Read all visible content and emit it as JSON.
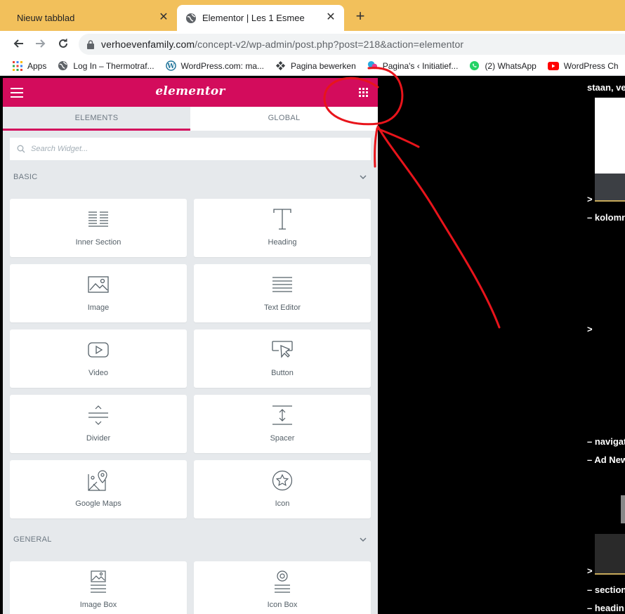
{
  "browser": {
    "tabs": [
      {
        "title": "Nieuw tabblad",
        "active": false
      },
      {
        "title": "Elementor | Les 1 Esmee",
        "active": true
      }
    ],
    "close_glyph": "✕",
    "new_tab_glyph": "+",
    "url_main": "verhoevenfamily.com",
    "url_path": "/concept-v2/wp-admin/post.php?post=218&action=elementor",
    "bookmarks": [
      {
        "label": "Apps",
        "icon": "apps-grid-icon"
      },
      {
        "label": "Log In – Thermotraf...",
        "icon": "globe-icon"
      },
      {
        "label": "WordPress.com: ma...",
        "icon": "wordpress-icon"
      },
      {
        "label": "Pagina bewerken",
        "icon": "puzzle-icon"
      },
      {
        "label": "Pagina's ‹ Initiatief...",
        "icon": "bookmark-icon"
      },
      {
        "label": "(2) WhatsApp",
        "icon": "whatsapp-icon"
      },
      {
        "label": "WordPress Ch",
        "icon": "youtube-icon"
      }
    ]
  },
  "elementor": {
    "logo": "elementor",
    "tabs": [
      "ELEMENTS",
      "GLOBAL"
    ],
    "search_placeholder": "Search Widget...",
    "categories": {
      "basic": "BASIC",
      "general": "GENERAL"
    },
    "basic_widgets": [
      {
        "label": "Inner Section",
        "icon": "inner-section-icon"
      },
      {
        "label": "Heading",
        "icon": "heading-icon"
      },
      {
        "label": "Image",
        "icon": "image-icon"
      },
      {
        "label": "Text Editor",
        "icon": "text-editor-icon"
      },
      {
        "label": "Video",
        "icon": "video-icon"
      },
      {
        "label": "Button",
        "icon": "button-icon"
      },
      {
        "label": "Divider",
        "icon": "divider-icon"
      },
      {
        "label": "Spacer",
        "icon": "spacer-icon"
      },
      {
        "label": "Google Maps",
        "icon": "google-maps-icon"
      },
      {
        "label": "Icon",
        "icon": "star-icon"
      }
    ],
    "general_widgets": [
      {
        "label": "Image Box",
        "icon": "image-box-icon"
      },
      {
        "label": "Icon Box",
        "icon": "icon-box-icon"
      }
    ]
  },
  "preview": {
    "lines": [
      "staan, ve",
      ">",
      "– kolomn",
      ">",
      "– navigat",
      "– Ad New",
      ">",
      "– section",
      "– headin"
    ]
  },
  "colors": {
    "accent": "#d30c5c",
    "tabstrip": "#f2c05b",
    "annotation": "#e8141b"
  }
}
